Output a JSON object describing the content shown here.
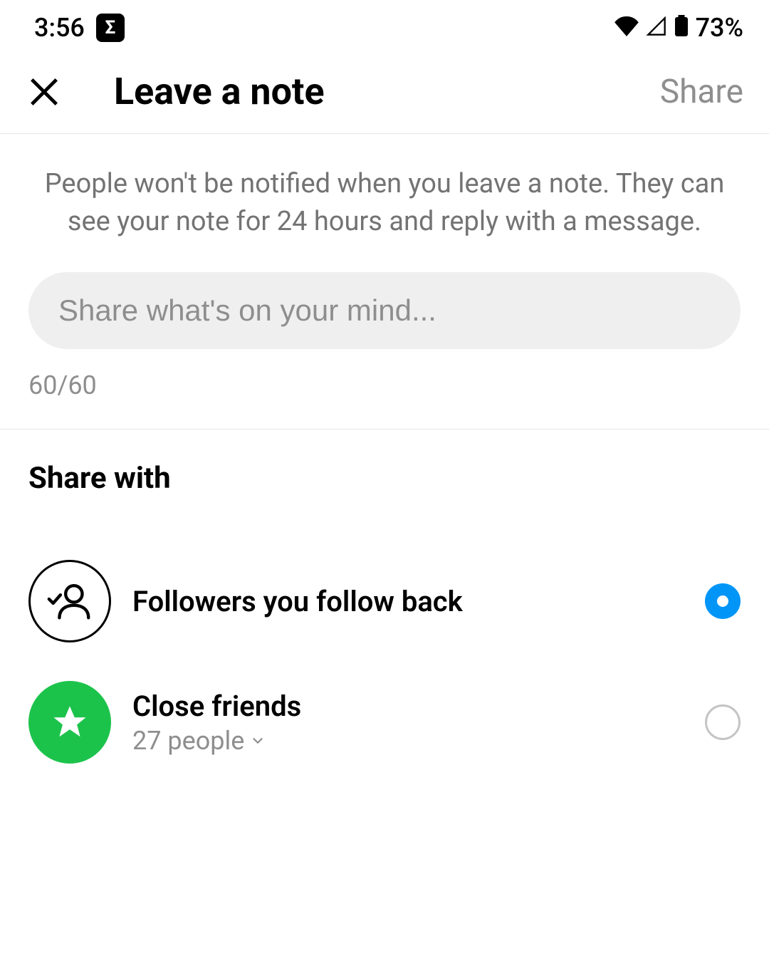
{
  "status": {
    "time": "3:56",
    "battery": "73%"
  },
  "header": {
    "title": "Leave a note",
    "share_button": "Share"
  },
  "info_text": "People won't be notified when you leave a note. They can see your note for 24 hours and reply with a message.",
  "note_input": {
    "placeholder": "Share what's on your mind...",
    "char_count": "60/60"
  },
  "share_section": {
    "title": "Share with",
    "options": [
      {
        "label": "Followers you follow back",
        "sublabel": "",
        "selected": true
      },
      {
        "label": "Close friends",
        "sublabel": "27 people",
        "selected": false
      }
    ]
  }
}
